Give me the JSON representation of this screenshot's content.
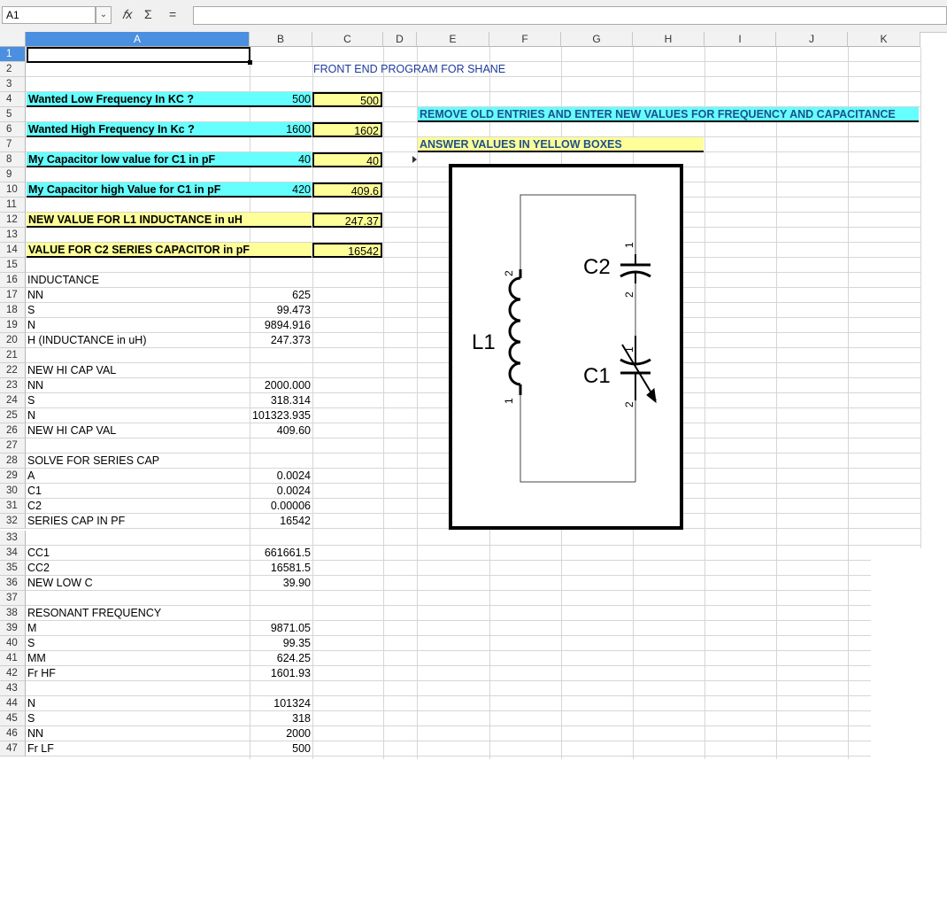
{
  "formula_bar": {
    "name_box": "A1",
    "name_box_dropdown": "⌄",
    "fx_icon": "𝑓x",
    "sum_icon": "Σ",
    "equals_icon": "="
  },
  "columns": [
    "A",
    "B",
    "C",
    "D",
    "E",
    "F",
    "G",
    "H",
    "I",
    "J",
    "K"
  ],
  "rows": [
    "1",
    "2",
    "3",
    "4",
    "5",
    "6",
    "7",
    "8",
    "9",
    "10",
    "11",
    "12",
    "13",
    "14",
    "15",
    "16",
    "17",
    "18",
    "19",
    "20",
    "21",
    "22",
    "23",
    "24",
    "25",
    "26",
    "27",
    "28",
    "29",
    "30",
    "31",
    "32",
    "33",
    "34",
    "35",
    "36",
    "37",
    "38",
    "39",
    "40",
    "41",
    "42",
    "43",
    "44",
    "45",
    "46",
    "47"
  ],
  "cells": {
    "title": "FRONT END PROGRAM FOR SHANE",
    "r4_label": "Wanted Low Frequency   In KC ?",
    "r4_b": "500",
    "r4_c": "500",
    "r6_label": "Wanted High Frequency  In Kc ?",
    "r6_b": "1600",
    "r6_c": "1602",
    "r8_label": "My Capacitor low value for C1 in pF",
    "r8_b": "40",
    "r8_c": "40",
    "r10_label": "My Capacitor high Value for  C1 in pF",
    "r10_b": "420",
    "r10_c": "409.6",
    "r12_label": "NEW  VALUE FOR  L1   INDUCTANCE in uH",
    "r12_c": "247.37",
    "r14_label": "VALUE FOR  C2  SERIES CAPACITOR in pF",
    "r14_c": "16542",
    "notice_remove": "REMOVE OLD ENTRIES AND   ENTER NEW VALUES FOR FREQUENCY AND CAPACITANCE",
    "notice_answer": "ANSWER  VALUES  IN  YELLOW BOXES",
    "r16": "INDUCTANCE",
    "r17": "NN",
    "r17_b": "625",
    "r18": "S",
    "r18_b": "99.473",
    "r19": "N",
    "r19_b": "9894.916",
    "r20": "H (INDUCTANCE in uH)",
    "r20_b": "247.373",
    "r22": "NEW HI CAP VAL",
    "r23": "NN",
    "r23_b": "2000.000",
    "r24": "S",
    "r24_b": "318.314",
    "r25": "N",
    "r25_b": "101323.935",
    "r26": "NEW HI CAP VAL",
    "r26_b": "409.60",
    "r28": "SOLVE FOR SERIES CAP",
    "r29": "A",
    "r29_b": "0.0024",
    "r30": "C1",
    "r30_b": "0.0024",
    "r31": "C2",
    "r31_b": "0.00006",
    "r32": "SERIES CAP   IN   PF",
    "r32_b": "16542",
    "r34": "CC1",
    "r34_b": "661661.5",
    "r35": "CC2",
    "r35_b": "16581.5",
    "r36": "NEW LOW C",
    "r36_b": "39.90",
    "r38": "RESONANT FREQUENCY",
    "r39": "M",
    "r39_b": "9871.05",
    "r40": "S",
    "r40_b": "99.35",
    "r41": "MM",
    "r41_b": "624.25",
    "r42": "Fr  HF",
    "r42_b": "1601.93",
    "r44": "N",
    "r44_b": "101324",
    "r45": "S",
    "r45_b": "318",
    "r46": "NN",
    "r46_b": "2000",
    "r47": "Fr   LF",
    "r47_b": "500"
  },
  "schematic": {
    "l1": "L1",
    "c1": "C1",
    "c2": "C2",
    "pin1": "1",
    "pin2": "2"
  },
  "colors": {
    "cyan": "#66ffff",
    "yellow": "#ffff99",
    "selection": "#4a8fe0",
    "title_blue": "#1f3a9e"
  }
}
